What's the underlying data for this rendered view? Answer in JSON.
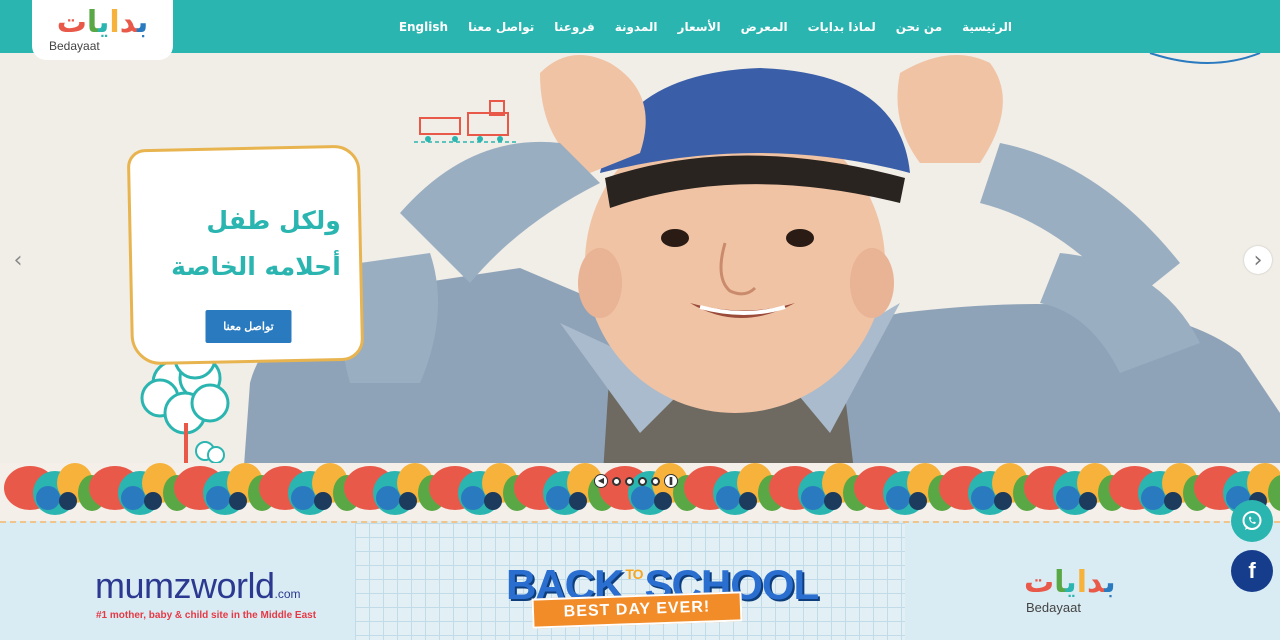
{
  "logo": {
    "arabic_letters": [
      "ب",
      "د",
      "ا",
      "ي",
      "ا",
      "ت"
    ],
    "english": "Bedayaat"
  },
  "nav": {
    "items": [
      {
        "label": "الرئيسية"
      },
      {
        "label": "من نحن"
      },
      {
        "label": "لماذا بدايات"
      },
      {
        "label": "المعرض"
      },
      {
        "label": "الأسعار"
      },
      {
        "label": "المدونة"
      },
      {
        "label": "فروعنا"
      },
      {
        "label": "تواصل معنا"
      },
      {
        "label": "English"
      }
    ]
  },
  "hero": {
    "slide": {
      "title_line1": "ولكل طفل",
      "title_line2": "أحلامه الخاصة",
      "button_label": "تواصل معنا"
    },
    "slider": {
      "slide_count": 4,
      "active_slide": 1
    },
    "arrows": {
      "prev": "‹",
      "next": "›"
    }
  },
  "banner": {
    "mumzworld_logo": "mumzworld",
    "mumzworld_domain": ".com",
    "mumzworld_tagline": "#1 mother, baby & child site in the Middle East",
    "back_to_school_1": "BACK",
    "back_to_school_to": "TO",
    "back_to_school_2": "SCHOOL",
    "ribbon": "BEST DAY EVER!",
    "partner_logo_en": "Bedayaat"
  },
  "social": {
    "whatsapp_icon": "whatsapp-icon",
    "facebook_icon": "facebook-icon",
    "facebook_letter": "f"
  },
  "colors": {
    "nav_bg": "#2bb5b0",
    "brand_teal": "#2bb5b0",
    "brand_blue": "#2a7abf",
    "card_border": "#e8b44f",
    "facebook_bg": "#163c8c"
  }
}
